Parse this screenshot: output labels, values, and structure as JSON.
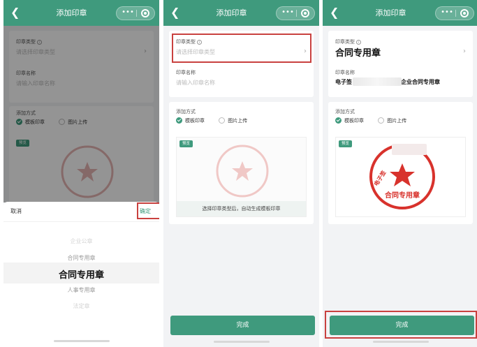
{
  "common": {
    "nav_title": "添加印章",
    "capsule_dots": "•••",
    "field_type_label": "印章类型",
    "field_type_placeholder": "请选择印章类型",
    "field_name_label": "印章名称",
    "field_name_placeholder": "请输入印章名称",
    "add_method_label": "添加方式",
    "option_template": "模板印章",
    "option_upload": "图片上传",
    "preview_badge": "预览",
    "preview_hint": "选择印章类型后，自动生成模板印章",
    "done_label": "完成"
  },
  "panel1": {
    "cancel": "取消",
    "confirm": "确定",
    "picker_items": [
      "企业公章",
      "合同专用章",
      "合同专用章",
      "人事专用章",
      "法定章"
    ]
  },
  "panel3": {
    "type_value": "合同专用章",
    "name_prefix": "电子签",
    "name_suffix": "企业合同专用章",
    "seal_text": "合同专用章",
    "seal_ring_text": "电子签"
  },
  "colors": {
    "brand": "#3f9a7d",
    "highlight": "#c9413f",
    "seal": "#d8322c"
  }
}
